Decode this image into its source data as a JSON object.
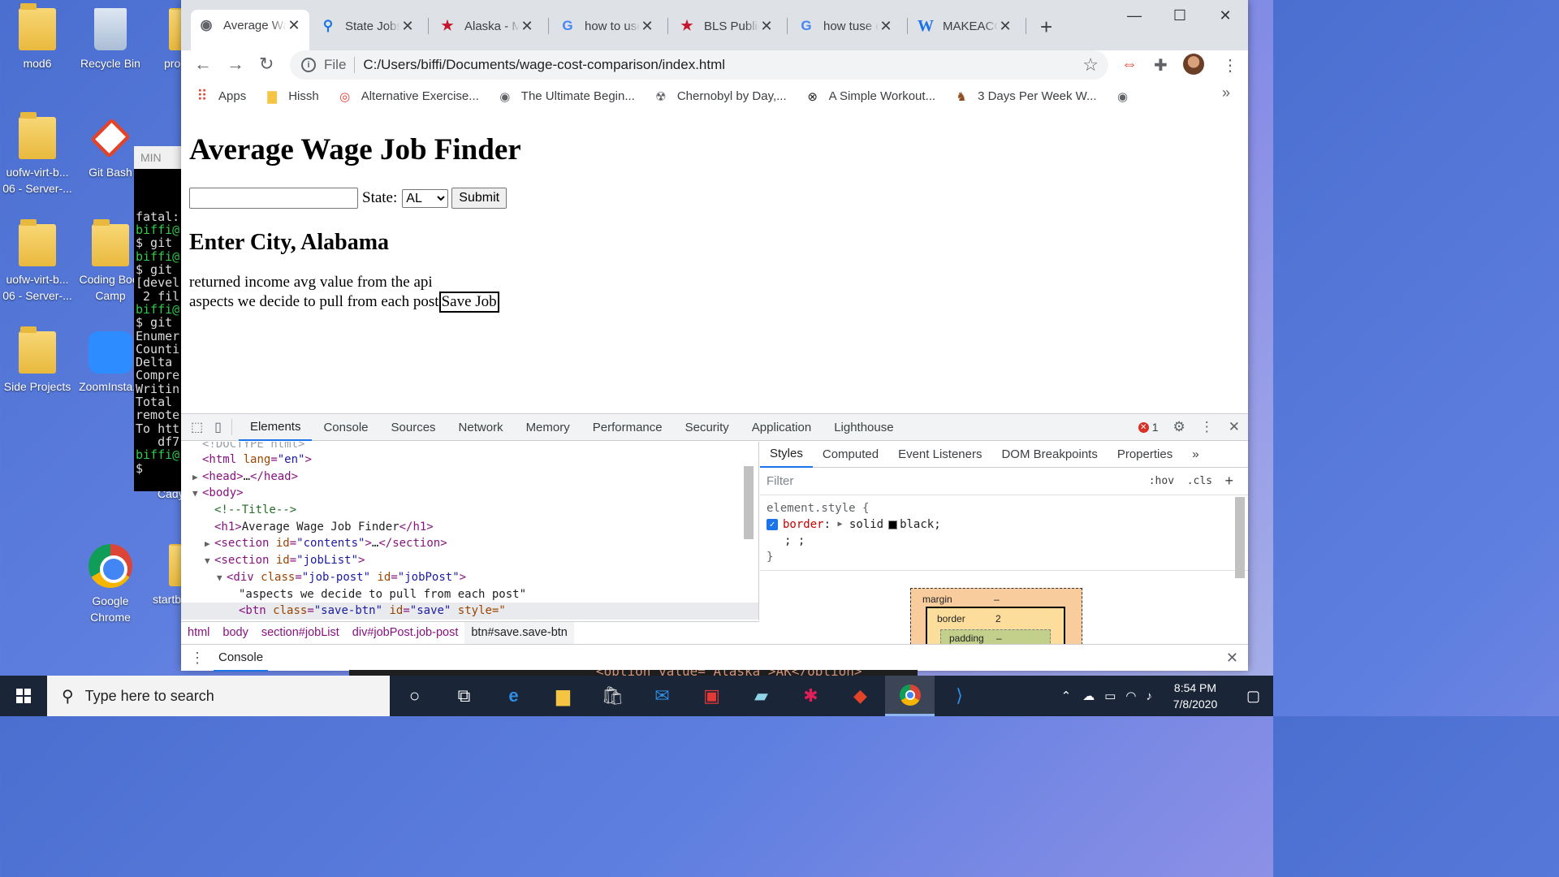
{
  "desktop": {
    "icons": [
      {
        "label": "mod6"
      },
      {
        "label": "Recycle Bin"
      },
      {
        "label": "pro"
      },
      {
        "label": "uofw-virt-b... 06 - Server-..."
      },
      {
        "label": "Git Bash"
      },
      {
        "label": "uofw-virt-b... 06 - Server-..."
      },
      {
        "label": "Coding Boot Camp"
      },
      {
        "label": "Side Projects"
      },
      {
        "label": "ZoomInsta..."
      },
      {
        "label": "Google Chrome"
      },
      {
        "label": "startb"
      },
      {
        "label": "Cady"
      }
    ],
    "terminal": {
      "title": "MIN",
      "lines": [
        "fatal:",
        "",
        "biffi@",
        "$ git ",
        "",
        "biffi@",
        "$ git ",
        "[devel",
        " 2 fil",
        "",
        "biffi@",
        "$ git ",
        "Enumer",
        "Counti",
        "Delta ",
        "Compre",
        "Writin",
        "Total ",
        "remote",
        "To htt",
        "   df7",
        "",
        "biffi@",
        "$"
      ]
    }
  },
  "browser": {
    "tabs": [
      {
        "label": "Average Wage Job Finder",
        "icon": "globe-icon",
        "active": true
      },
      {
        "label": "State Jobs",
        "icon": "info-icon"
      },
      {
        "label": "Alaska - Major Employers",
        "icon": "star-icon"
      },
      {
        "label": "how to use",
        "icon": "google-icon"
      },
      {
        "label": "BLS Public Data",
        "icon": "star-icon"
      },
      {
        "label": "how tuse c",
        "icon": "google-icon"
      },
      {
        "label": "MAKEACOMMIT",
        "icon": "w-icon"
      }
    ],
    "window_controls": {
      "minimize": "—",
      "maximize": "☐",
      "close": "✕"
    },
    "address": {
      "scheme": "File",
      "url": "C:/Users/biffi/Documents/wage-cost-comparison/index.html"
    },
    "bookmarks": [
      {
        "label": "Apps",
        "icon": "apps-grid-icon"
      },
      {
        "label": "Hissh",
        "icon": "folder-icon"
      },
      {
        "label": "Alternative Exercise...",
        "icon": "target-icon"
      },
      {
        "label": "The Ultimate Begin...",
        "icon": "globe-icon"
      },
      {
        "label": "Chernobyl by Day,...",
        "icon": "radiation-icon"
      },
      {
        "label": "A Simple Workout...",
        "icon": "x-circle-icon"
      },
      {
        "label": "3 Days Per Week W...",
        "icon": "runner-icon"
      }
    ]
  },
  "page": {
    "title": "Average Wage Job Finder",
    "state_label": "State:",
    "state_selected": "AL",
    "submit_label": "Submit",
    "heading": "Enter City, Alabama",
    "income_text": "returned income avg value from the api",
    "post_text": "aspects we decide to pull from each post",
    "save_label": "Save Job"
  },
  "devtools": {
    "tabs": [
      "Elements",
      "Console",
      "Sources",
      "Network",
      "Memory",
      "Performance",
      "Security",
      "Application",
      "Lighthouse"
    ],
    "error_count": "1",
    "dom": [
      {
        "indent": 0,
        "tri": "",
        "html": "<!DOCTYPE html>",
        "kind": "doctype"
      },
      {
        "indent": 0,
        "tri": "",
        "kind": "open",
        "tag": "html",
        "attrs": [
          [
            "lang",
            "en"
          ]
        ]
      },
      {
        "indent": 0,
        "tri": "▶",
        "kind": "collapsed",
        "tag": "head"
      },
      {
        "indent": 0,
        "tri": "▼",
        "kind": "open",
        "tag": "body",
        "attrs": []
      },
      {
        "indent": 1,
        "tri": "",
        "kind": "comment",
        "text": "<!--Title-->"
      },
      {
        "indent": 1,
        "tri": "",
        "kind": "inline",
        "tag": "h1",
        "text": "Average Wage Job Finder"
      },
      {
        "indent": 1,
        "tri": "▶",
        "kind": "collapsed",
        "tag": "section",
        "attrs": [
          [
            "id",
            "contents"
          ]
        ]
      },
      {
        "indent": 1,
        "tri": "▼",
        "kind": "open",
        "tag": "section",
        "attrs": [
          [
            "id",
            "jobList"
          ]
        ]
      },
      {
        "indent": 2,
        "tri": "▼",
        "kind": "open",
        "tag": "div",
        "attrs": [
          [
            "class",
            "job-post"
          ],
          [
            "id",
            "jobPost"
          ]
        ]
      },
      {
        "indent": 3,
        "tri": "",
        "kind": "text",
        "text": "\"aspects we decide to pull from each post\""
      },
      {
        "indent": 3,
        "tri": "",
        "kind": "partial",
        "tag": "btn",
        "attrs": [
          [
            "class",
            "save-btn"
          ],
          [
            "id",
            "save"
          ]
        ],
        "tail": " style=\"",
        "selected": true
      }
    ],
    "breadcrumbs": [
      "html",
      "body",
      "section#jobList",
      "div#jobPost.job-post",
      "btn#save.save-btn"
    ],
    "styles_tabs": [
      "Styles",
      "Computed",
      "Event Listeners",
      "DOM Breakpoints",
      "Properties",
      "»"
    ],
    "filter_placeholder": "Filter",
    "hov": ":hov",
    "cls": ".cls",
    "rule_selector": "element.style {",
    "rule_prop": "border",
    "rule_value_pre": "solid",
    "rule_value_post": "black;",
    "rule_extra": "; ;",
    "rule_close": "}",
    "boxmodel": {
      "margin_label": "margin",
      "margin_val": "–",
      "border_label": "border",
      "border_val": "2",
      "padding_label": "padding",
      "padding_val": "–"
    },
    "drawer_label": "Console"
  },
  "taskbar": {
    "search_placeholder": "Type here to search",
    "time": "8:54 PM",
    "date": "7/8/2020"
  },
  "code_peek": "<option value=\"Alaska\">AK</option>"
}
